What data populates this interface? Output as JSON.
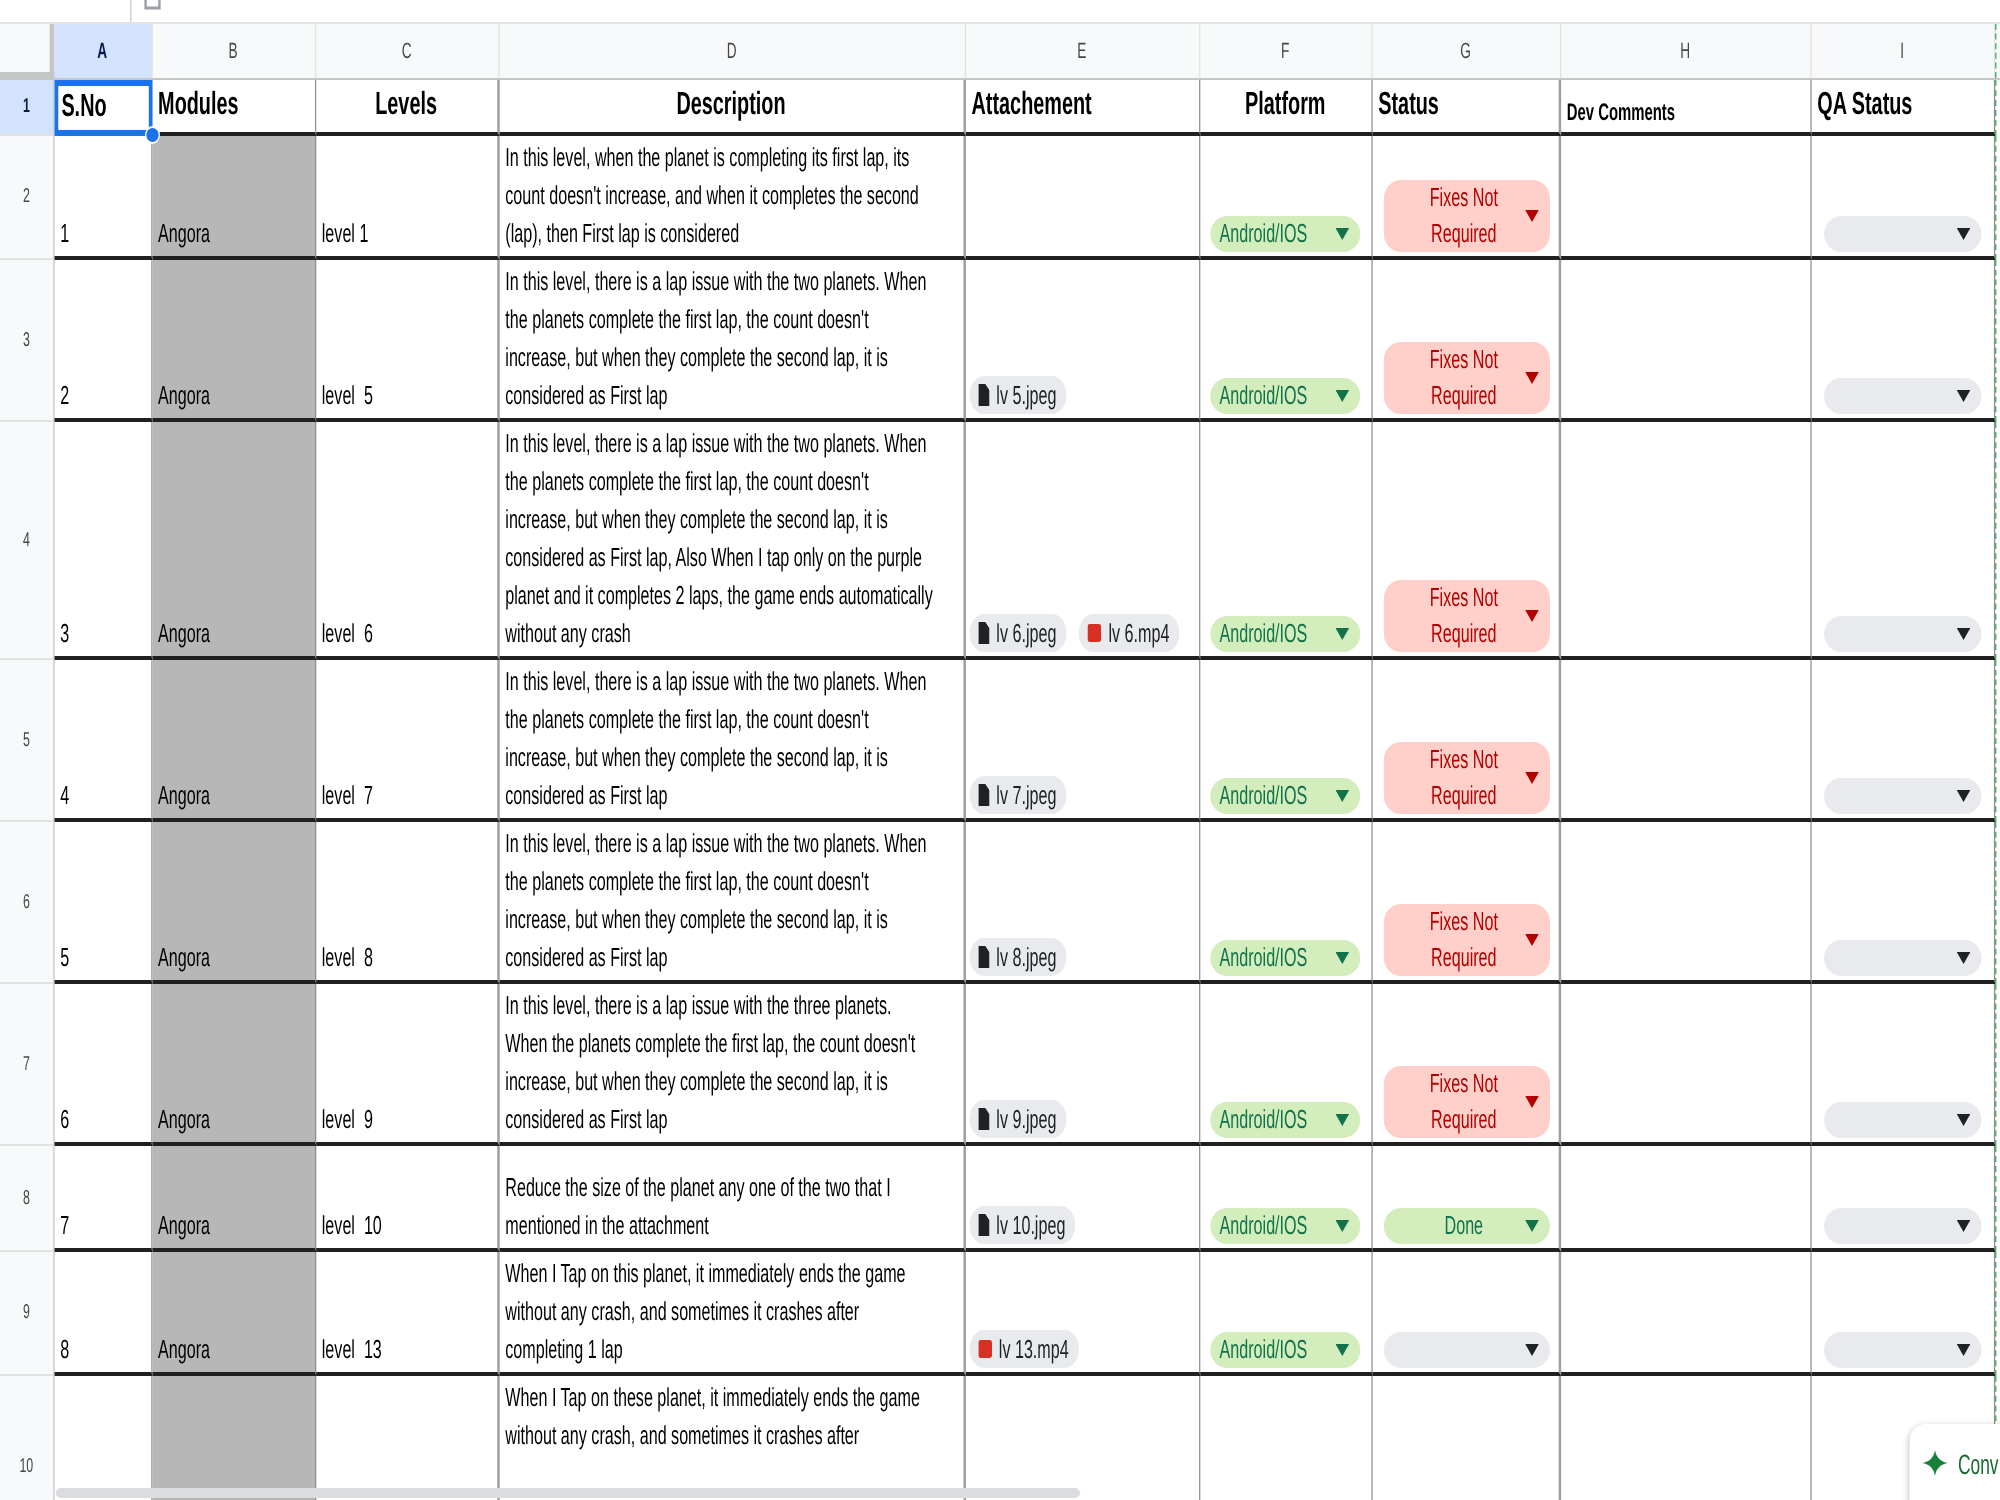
{
  "columns": [
    {
      "letter": "A",
      "selected": true
    },
    {
      "letter": "B",
      "selected": false
    },
    {
      "letter": "C",
      "selected": false
    },
    {
      "letter": "D",
      "selected": false
    },
    {
      "letter": "E",
      "selected": false
    },
    {
      "letter": "F",
      "selected": false
    },
    {
      "letter": "G",
      "selected": false
    },
    {
      "letter": "H",
      "selected": false
    },
    {
      "letter": "I",
      "selected": false
    }
  ],
  "header_row": {
    "row_number": "1",
    "selected": true,
    "cells": [
      {
        "text": "S.No",
        "selected": true
      },
      {
        "text": "Modules",
        "selected": false
      },
      {
        "text": "Levels",
        "selected": false
      },
      {
        "text": "Description",
        "selected": false
      },
      {
        "text": "Attachement",
        "selected": false
      },
      {
        "text": "Platform",
        "selected": false
      },
      {
        "text": "Status",
        "selected": false
      },
      {
        "text": "Dev Comments",
        "selected": false
      },
      {
        "text": "QA Status",
        "selected": false
      }
    ]
  },
  "rows": [
    {
      "row_number": "2",
      "selected": false,
      "sno": "1",
      "module": "Angora",
      "level": "level 1",
      "description": "In this level, when the planet is completing its first lap, its count doesn't increase, and when it completes the second (lap), then First lap is considered",
      "platform": {
        "label": "Android/IOS",
        "color": "#d4edbc"
      },
      "status": {
        "label": "Fixes Not Required",
        "color": "#ffcfc9"
      },
      "qa_status": {
        "color": "#e8eaed"
      }
    },
    {
      "row_number": "3",
      "selected": false,
      "sno": "2",
      "module": "Angora",
      "level": "level  5",
      "description": "In this level, there is a lap issue with the two planets. When the planets complete the first lap, the count doesn't increase, but when they complete the second lap, it is considered as First lap",
      "attachments": [
        {
          "kind": "image",
          "name": "lv 5.jpeg"
        }
      ],
      "platform": {
        "label": "Android/IOS",
        "color": "#d4edbc"
      },
      "status": {
        "label": "Fixes Not Required",
        "color": "#ffcfc9"
      },
      "qa_status": {
        "color": "#e8eaed"
      }
    },
    {
      "row_number": "4",
      "selected": false,
      "sno": "3",
      "module": "Angora",
      "level": "level  6",
      "description": "In this level, there is a lap issue with the two planets. When the planets complete the first lap, the count doesn't increase, but when they complete the second lap, it is considered as First lap, Also When I tap only on the purple planet and it completes 2 laps, the game ends automatically without any crash",
      "attachments": [
        {
          "kind": "image",
          "name": "lv 6.jpeg"
        },
        {
          "kind": "video",
          "name": "lv 6.mp4"
        }
      ],
      "platform": {
        "label": "Android/IOS",
        "color": "#d4edbc"
      },
      "status": {
        "label": "Fixes Not Required",
        "color": "#ffcfc9"
      },
      "qa_status": {
        "color": "#e8eaed"
      }
    },
    {
      "row_number": "5",
      "selected": false,
      "sno": "4",
      "module": "Angora",
      "level": "level  7",
      "description": "In this level, there is a lap issue with the two planets. When the planets complete the first lap, the count doesn't increase, but when they complete the second lap, it is considered as First lap",
      "attachments": [
        {
          "kind": "image",
          "name": "lv 7.jpeg"
        }
      ],
      "platform": {
        "label": "Android/IOS",
        "color": "#d4edbc"
      },
      "status": {
        "label": "Fixes Not Required",
        "color": "#ffcfc9"
      },
      "qa_status": {
        "color": "#e8eaed"
      }
    },
    {
      "row_number": "6",
      "selected": false,
      "sno": "5",
      "module": "Angora",
      "level": "level  8",
      "description": "In this level, there is a lap issue with the two planets. When the planets complete the first lap, the count doesn't increase, but when they complete the second lap, it is considered as First lap",
      "attachments": [
        {
          "kind": "image",
          "name": "lv 8.jpeg"
        }
      ],
      "platform": {
        "label": "Android/IOS",
        "color": "#d4edbc"
      },
      "status": {
        "label": "Fixes Not Required",
        "color": "#ffcfc9"
      },
      "qa_status": {
        "color": "#e8eaed"
      }
    },
    {
      "row_number": "7",
      "selected": false,
      "sno": "6",
      "module": "Angora",
      "level": "level  9",
      "description": "In this level, there is a lap issue with the three planets. When the planets complete the first lap, the count doesn't increase, but when they complete the second lap, it is considered as First lap",
      "attachments": [
        {
          "kind": "image",
          "name": "lv 9.jpeg"
        }
      ],
      "platform": {
        "label": "Android/IOS",
        "color": "#d4edbc"
      },
      "status": {
        "label": "Fixes Not Required",
        "color": "#ffcfc9"
      },
      "qa_status": {
        "color": "#e8eaed"
      }
    },
    {
      "row_number": "8",
      "selected": false,
      "sno": "7",
      "module": "Angora",
      "level": "level  10",
      "description": "Reduce the size of the planet any one of the two that I mentioned in the attachment",
      "attachments": [
        {
          "kind": "image",
          "name": "lv 10.jpeg"
        }
      ],
      "platform": {
        "label": "Android/IOS",
        "color": "#d4edbc"
      },
      "status": {
        "label": "Done",
        "color": "#d4edbc"
      },
      "qa_status": {
        "color": "#e8eaed"
      }
    },
    {
      "row_number": "9",
      "selected": false,
      "sno": "8",
      "module": "Angora",
      "level": "level  13",
      "description": "When I Tap on this planet, it immediately ends the game without any crash, and sometimes it crashes after completing 1 lap",
      "attachments": [
        {
          "kind": "video",
          "name": "lv 13.mp4"
        }
      ],
      "platform": {
        "label": "Android/IOS",
        "color": "#d4edbc"
      },
      "status": {
        "color": "#e8eaed"
      },
      "qa_status": {
        "color": "#e8eaed"
      }
    },
    {
      "row_number": "10",
      "selected": false,
      "description": "When I Tap on these planet, it immediately ends the game without any crash, and sometimes it crashes after"
    }
  ],
  "assistant_button": {
    "label": "Conv"
  }
}
